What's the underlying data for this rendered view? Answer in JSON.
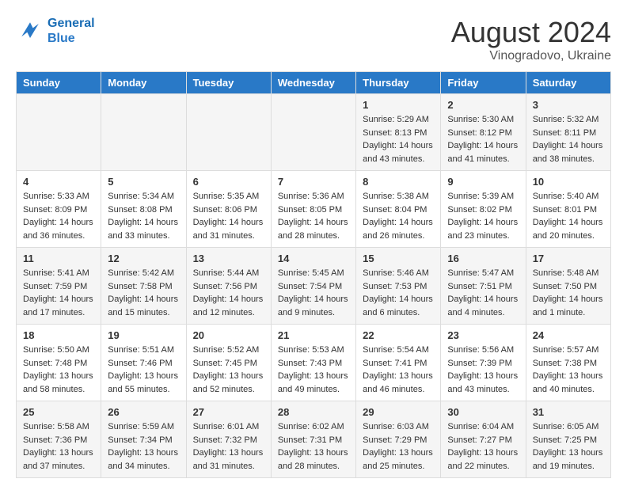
{
  "header": {
    "logo_line1": "General",
    "logo_line2": "Blue",
    "month_year": "August 2024",
    "location": "Vinogradovo, Ukraine"
  },
  "weekdays": [
    "Sunday",
    "Monday",
    "Tuesday",
    "Wednesday",
    "Thursday",
    "Friday",
    "Saturday"
  ],
  "weeks": [
    [
      {
        "day": "",
        "info": ""
      },
      {
        "day": "",
        "info": ""
      },
      {
        "day": "",
        "info": ""
      },
      {
        "day": "",
        "info": ""
      },
      {
        "day": "1",
        "info": "Sunrise: 5:29 AM\nSunset: 8:13 PM\nDaylight: 14 hours\nand 43 minutes."
      },
      {
        "day": "2",
        "info": "Sunrise: 5:30 AM\nSunset: 8:12 PM\nDaylight: 14 hours\nand 41 minutes."
      },
      {
        "day": "3",
        "info": "Sunrise: 5:32 AM\nSunset: 8:11 PM\nDaylight: 14 hours\nand 38 minutes."
      }
    ],
    [
      {
        "day": "4",
        "info": "Sunrise: 5:33 AM\nSunset: 8:09 PM\nDaylight: 14 hours\nand 36 minutes."
      },
      {
        "day": "5",
        "info": "Sunrise: 5:34 AM\nSunset: 8:08 PM\nDaylight: 14 hours\nand 33 minutes."
      },
      {
        "day": "6",
        "info": "Sunrise: 5:35 AM\nSunset: 8:06 PM\nDaylight: 14 hours\nand 31 minutes."
      },
      {
        "day": "7",
        "info": "Sunrise: 5:36 AM\nSunset: 8:05 PM\nDaylight: 14 hours\nand 28 minutes."
      },
      {
        "day": "8",
        "info": "Sunrise: 5:38 AM\nSunset: 8:04 PM\nDaylight: 14 hours\nand 26 minutes."
      },
      {
        "day": "9",
        "info": "Sunrise: 5:39 AM\nSunset: 8:02 PM\nDaylight: 14 hours\nand 23 minutes."
      },
      {
        "day": "10",
        "info": "Sunrise: 5:40 AM\nSunset: 8:01 PM\nDaylight: 14 hours\nand 20 minutes."
      }
    ],
    [
      {
        "day": "11",
        "info": "Sunrise: 5:41 AM\nSunset: 7:59 PM\nDaylight: 14 hours\nand 17 minutes."
      },
      {
        "day": "12",
        "info": "Sunrise: 5:42 AM\nSunset: 7:58 PM\nDaylight: 14 hours\nand 15 minutes."
      },
      {
        "day": "13",
        "info": "Sunrise: 5:44 AM\nSunset: 7:56 PM\nDaylight: 14 hours\nand 12 minutes."
      },
      {
        "day": "14",
        "info": "Sunrise: 5:45 AM\nSunset: 7:54 PM\nDaylight: 14 hours\nand 9 minutes."
      },
      {
        "day": "15",
        "info": "Sunrise: 5:46 AM\nSunset: 7:53 PM\nDaylight: 14 hours\nand 6 minutes."
      },
      {
        "day": "16",
        "info": "Sunrise: 5:47 AM\nSunset: 7:51 PM\nDaylight: 14 hours\nand 4 minutes."
      },
      {
        "day": "17",
        "info": "Sunrise: 5:48 AM\nSunset: 7:50 PM\nDaylight: 14 hours\nand 1 minute."
      }
    ],
    [
      {
        "day": "18",
        "info": "Sunrise: 5:50 AM\nSunset: 7:48 PM\nDaylight: 13 hours\nand 58 minutes."
      },
      {
        "day": "19",
        "info": "Sunrise: 5:51 AM\nSunset: 7:46 PM\nDaylight: 13 hours\nand 55 minutes."
      },
      {
        "day": "20",
        "info": "Sunrise: 5:52 AM\nSunset: 7:45 PM\nDaylight: 13 hours\nand 52 minutes."
      },
      {
        "day": "21",
        "info": "Sunrise: 5:53 AM\nSunset: 7:43 PM\nDaylight: 13 hours\nand 49 minutes."
      },
      {
        "day": "22",
        "info": "Sunrise: 5:54 AM\nSunset: 7:41 PM\nDaylight: 13 hours\nand 46 minutes."
      },
      {
        "day": "23",
        "info": "Sunrise: 5:56 AM\nSunset: 7:39 PM\nDaylight: 13 hours\nand 43 minutes."
      },
      {
        "day": "24",
        "info": "Sunrise: 5:57 AM\nSunset: 7:38 PM\nDaylight: 13 hours\nand 40 minutes."
      }
    ],
    [
      {
        "day": "25",
        "info": "Sunrise: 5:58 AM\nSunset: 7:36 PM\nDaylight: 13 hours\nand 37 minutes."
      },
      {
        "day": "26",
        "info": "Sunrise: 5:59 AM\nSunset: 7:34 PM\nDaylight: 13 hours\nand 34 minutes."
      },
      {
        "day": "27",
        "info": "Sunrise: 6:01 AM\nSunset: 7:32 PM\nDaylight: 13 hours\nand 31 minutes."
      },
      {
        "day": "28",
        "info": "Sunrise: 6:02 AM\nSunset: 7:31 PM\nDaylight: 13 hours\nand 28 minutes."
      },
      {
        "day": "29",
        "info": "Sunrise: 6:03 AM\nSunset: 7:29 PM\nDaylight: 13 hours\nand 25 minutes."
      },
      {
        "day": "30",
        "info": "Sunrise: 6:04 AM\nSunset: 7:27 PM\nDaylight: 13 hours\nand 22 minutes."
      },
      {
        "day": "31",
        "info": "Sunrise: 6:05 AM\nSunset: 7:25 PM\nDaylight: 13 hours\nand 19 minutes."
      }
    ]
  ]
}
